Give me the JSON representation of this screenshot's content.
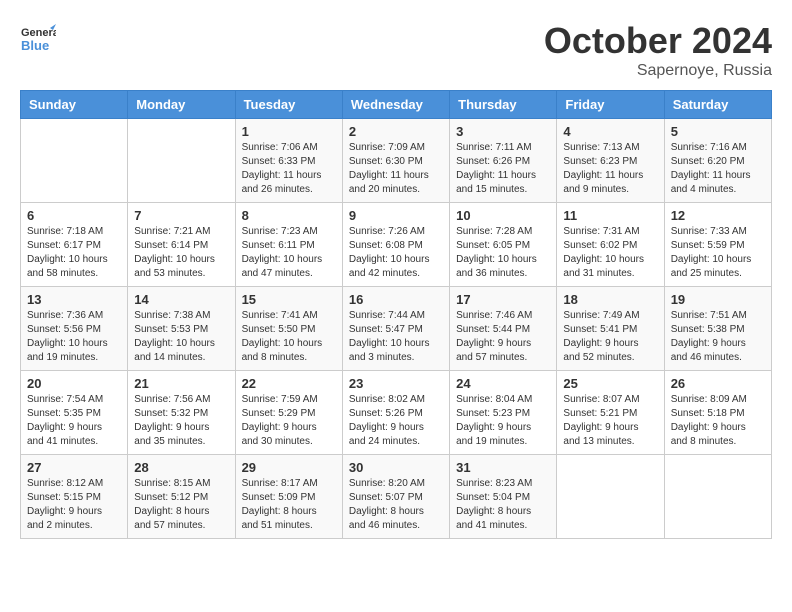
{
  "logo": {
    "line1": "General",
    "line2": "Blue"
  },
  "title": "October 2024",
  "subtitle": "Sapernoye, Russia",
  "days_header": [
    "Sunday",
    "Monday",
    "Tuesday",
    "Wednesday",
    "Thursday",
    "Friday",
    "Saturday"
  ],
  "weeks": [
    [
      {
        "day": "",
        "info": ""
      },
      {
        "day": "",
        "info": ""
      },
      {
        "day": "1",
        "info": "Sunrise: 7:06 AM\nSunset: 6:33 PM\nDaylight: 11 hours and 26 minutes."
      },
      {
        "day": "2",
        "info": "Sunrise: 7:09 AM\nSunset: 6:30 PM\nDaylight: 11 hours and 20 minutes."
      },
      {
        "day": "3",
        "info": "Sunrise: 7:11 AM\nSunset: 6:26 PM\nDaylight: 11 hours and 15 minutes."
      },
      {
        "day": "4",
        "info": "Sunrise: 7:13 AM\nSunset: 6:23 PM\nDaylight: 11 hours and 9 minutes."
      },
      {
        "day": "5",
        "info": "Sunrise: 7:16 AM\nSunset: 6:20 PM\nDaylight: 11 hours and 4 minutes."
      }
    ],
    [
      {
        "day": "6",
        "info": "Sunrise: 7:18 AM\nSunset: 6:17 PM\nDaylight: 10 hours and 58 minutes."
      },
      {
        "day": "7",
        "info": "Sunrise: 7:21 AM\nSunset: 6:14 PM\nDaylight: 10 hours and 53 minutes."
      },
      {
        "day": "8",
        "info": "Sunrise: 7:23 AM\nSunset: 6:11 PM\nDaylight: 10 hours and 47 minutes."
      },
      {
        "day": "9",
        "info": "Sunrise: 7:26 AM\nSunset: 6:08 PM\nDaylight: 10 hours and 42 minutes."
      },
      {
        "day": "10",
        "info": "Sunrise: 7:28 AM\nSunset: 6:05 PM\nDaylight: 10 hours and 36 minutes."
      },
      {
        "day": "11",
        "info": "Sunrise: 7:31 AM\nSunset: 6:02 PM\nDaylight: 10 hours and 31 minutes."
      },
      {
        "day": "12",
        "info": "Sunrise: 7:33 AM\nSunset: 5:59 PM\nDaylight: 10 hours and 25 minutes."
      }
    ],
    [
      {
        "day": "13",
        "info": "Sunrise: 7:36 AM\nSunset: 5:56 PM\nDaylight: 10 hours and 19 minutes."
      },
      {
        "day": "14",
        "info": "Sunrise: 7:38 AM\nSunset: 5:53 PM\nDaylight: 10 hours and 14 minutes."
      },
      {
        "day": "15",
        "info": "Sunrise: 7:41 AM\nSunset: 5:50 PM\nDaylight: 10 hours and 8 minutes."
      },
      {
        "day": "16",
        "info": "Sunrise: 7:44 AM\nSunset: 5:47 PM\nDaylight: 10 hours and 3 minutes."
      },
      {
        "day": "17",
        "info": "Sunrise: 7:46 AM\nSunset: 5:44 PM\nDaylight: 9 hours and 57 minutes."
      },
      {
        "day": "18",
        "info": "Sunrise: 7:49 AM\nSunset: 5:41 PM\nDaylight: 9 hours and 52 minutes."
      },
      {
        "day": "19",
        "info": "Sunrise: 7:51 AM\nSunset: 5:38 PM\nDaylight: 9 hours and 46 minutes."
      }
    ],
    [
      {
        "day": "20",
        "info": "Sunrise: 7:54 AM\nSunset: 5:35 PM\nDaylight: 9 hours and 41 minutes."
      },
      {
        "day": "21",
        "info": "Sunrise: 7:56 AM\nSunset: 5:32 PM\nDaylight: 9 hours and 35 minutes."
      },
      {
        "day": "22",
        "info": "Sunrise: 7:59 AM\nSunset: 5:29 PM\nDaylight: 9 hours and 30 minutes."
      },
      {
        "day": "23",
        "info": "Sunrise: 8:02 AM\nSunset: 5:26 PM\nDaylight: 9 hours and 24 minutes."
      },
      {
        "day": "24",
        "info": "Sunrise: 8:04 AM\nSunset: 5:23 PM\nDaylight: 9 hours and 19 minutes."
      },
      {
        "day": "25",
        "info": "Sunrise: 8:07 AM\nSunset: 5:21 PM\nDaylight: 9 hours and 13 minutes."
      },
      {
        "day": "26",
        "info": "Sunrise: 8:09 AM\nSunset: 5:18 PM\nDaylight: 9 hours and 8 minutes."
      }
    ],
    [
      {
        "day": "27",
        "info": "Sunrise: 8:12 AM\nSunset: 5:15 PM\nDaylight: 9 hours and 2 minutes."
      },
      {
        "day": "28",
        "info": "Sunrise: 8:15 AM\nSunset: 5:12 PM\nDaylight: 8 hours and 57 minutes."
      },
      {
        "day": "29",
        "info": "Sunrise: 8:17 AM\nSunset: 5:09 PM\nDaylight: 8 hours and 51 minutes."
      },
      {
        "day": "30",
        "info": "Sunrise: 8:20 AM\nSunset: 5:07 PM\nDaylight: 8 hours and 46 minutes."
      },
      {
        "day": "31",
        "info": "Sunrise: 8:23 AM\nSunset: 5:04 PM\nDaylight: 8 hours and 41 minutes."
      },
      {
        "day": "",
        "info": ""
      },
      {
        "day": "",
        "info": ""
      }
    ]
  ]
}
